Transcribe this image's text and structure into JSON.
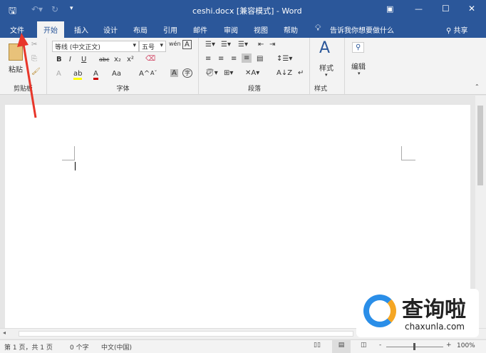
{
  "window": {
    "title": "ceshi.docx [兼容模式] - Word",
    "accent": "#2b579a"
  },
  "qat": {
    "save": "save-icon",
    "undo": "undo-icon",
    "redo": "redo-icon",
    "more": "▾"
  },
  "controls": {
    "ribbon_display": "▣",
    "minimize": "—",
    "maximize": "☐",
    "close": "✕"
  },
  "tabs": [
    "文件",
    "开始",
    "插入",
    "设计",
    "布局",
    "引用",
    "邮件",
    "审阅",
    "视图",
    "帮助"
  ],
  "tell_me": "告诉我你想要做什么",
  "share": "共享",
  "ribbon": {
    "clipboard": {
      "paste": "粘贴",
      "label": "剪贴板"
    },
    "font": {
      "name": "等线 (中文正文)",
      "size": "五号",
      "bold": "B",
      "italic": "I",
      "underline": "U",
      "strike": "abc",
      "sub": "x₂",
      "sup": "x²",
      "font_color": "A",
      "change_case": "Aa",
      "grow": "A^",
      "shrink": "Aˇ",
      "label": "字体"
    },
    "paragraph": {
      "label": "段落"
    },
    "styles": {
      "button": "样式",
      "label": "样式"
    },
    "editing": {
      "button": "编辑"
    }
  },
  "status": {
    "page": "第 1 页，共 1 页",
    "words": "0 个字",
    "language": "中文(中国)",
    "zoom": "100%",
    "zoom_minus": "-",
    "zoom_plus": "+"
  },
  "watermark": {
    "brand": "查询啦",
    "url": "chaxunla.com"
  }
}
